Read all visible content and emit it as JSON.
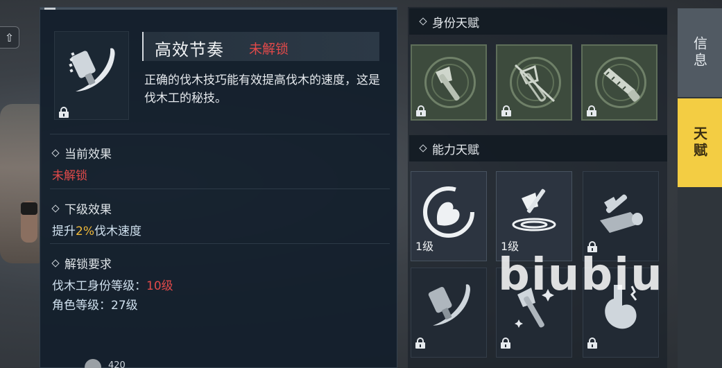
{
  "skill": {
    "name": "高效节奏",
    "status": "未解锁",
    "description": "正确的伐木技巧能有效提高伐木的速度，这是伐木工的秘技。",
    "icon": "chainsaw-swoosh-icon"
  },
  "current_effect": {
    "heading": "当前效果",
    "value": "未解锁"
  },
  "next_effect": {
    "heading": "下级效果",
    "prefix": "提升",
    "amount": "2%",
    "suffix": "伐木速度"
  },
  "requirements": {
    "heading": "解锁要求",
    "line1_label": "伐木工身份等级：",
    "line1_value": "10级",
    "line2": "角色等级：27级"
  },
  "footer": {
    "count": "420"
  },
  "identity_talents": {
    "heading": "身份天赋",
    "tiles": [
      {
        "icon": "axe-icon",
        "locked": true
      },
      {
        "icon": "crossed-axe-icon",
        "locked": true
      },
      {
        "icon": "saw-icon",
        "locked": true
      }
    ]
  },
  "ability_talents": {
    "heading": "能力天赋",
    "tiles": [
      {
        "icon": "flexed-arm-icon",
        "level": "1级",
        "locked": false
      },
      {
        "icon": "axe-chop-icon",
        "level": "1级",
        "locked": false
      },
      {
        "icon": "log-axe-icon",
        "level": "",
        "locked": true
      },
      {
        "icon": "chainsaw-swoosh-icon",
        "level": "",
        "locked": true
      },
      {
        "icon": "sparkle-axe-icon",
        "level": "",
        "locked": true
      },
      {
        "icon": "stomach-icon",
        "level": "",
        "locked": true
      }
    ]
  },
  "tabs": {
    "info": "信息",
    "talent": "天赋"
  },
  "watermark": "biubiu",
  "colors": {
    "accent_yellow": "#f3cd43",
    "locked_red": "#e24a4a",
    "highlight_yellow": "#f0b93a"
  }
}
